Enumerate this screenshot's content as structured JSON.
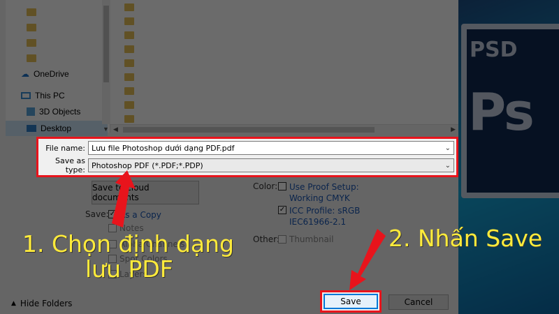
{
  "background": {
    "accent": "#16a6d8"
  },
  "nav": {
    "items": [
      {
        "label": "OneDrive",
        "icon": "cloud-icon"
      },
      {
        "label": "This PC",
        "icon": "computer-icon"
      },
      {
        "label": "3D Objects",
        "icon": "cube-icon"
      },
      {
        "label": "Desktop",
        "icon": "desktop-icon"
      }
    ]
  },
  "fields": {
    "file_name_label": "File name:",
    "file_name_value": "Lưu file Photoshop dưới dạng PDF.pdf",
    "save_type_label": "Save as type:",
    "save_type_value": "Photoshop PDF (*.PDF;*.PDP)"
  },
  "options": {
    "cloud_button": "Save to cloud documents",
    "save_label": "Save:",
    "as_copy": "As a Copy",
    "notes": "Notes",
    "alpha_channels": "Alpha Channels",
    "spot_colors": "Spot Colors",
    "layers": "Layers",
    "color_label": "Color:",
    "use_proof": "Use Proof Setup:",
    "working_cmyk": "Working CMYK",
    "icc_profile": "ICC Profile:  sRGB",
    "icc_value": "IEC61966-2.1",
    "other_label": "Other:",
    "thumbnail": "Thumbnail"
  },
  "footer": {
    "hide_folders": "Hide Folders",
    "save": "Save",
    "cancel": "Cancel"
  },
  "annotations": {
    "step1_line1": "1. Chọn định dạng",
    "step1_line2": "lưu PDF",
    "step2": "2. Nhấn Save"
  },
  "colors": {
    "highlight_red": "#e8141c",
    "annotation_yellow": "#ffeb3b"
  },
  "logo": {
    "psd": "PSD",
    "ps": "Ps"
  }
}
